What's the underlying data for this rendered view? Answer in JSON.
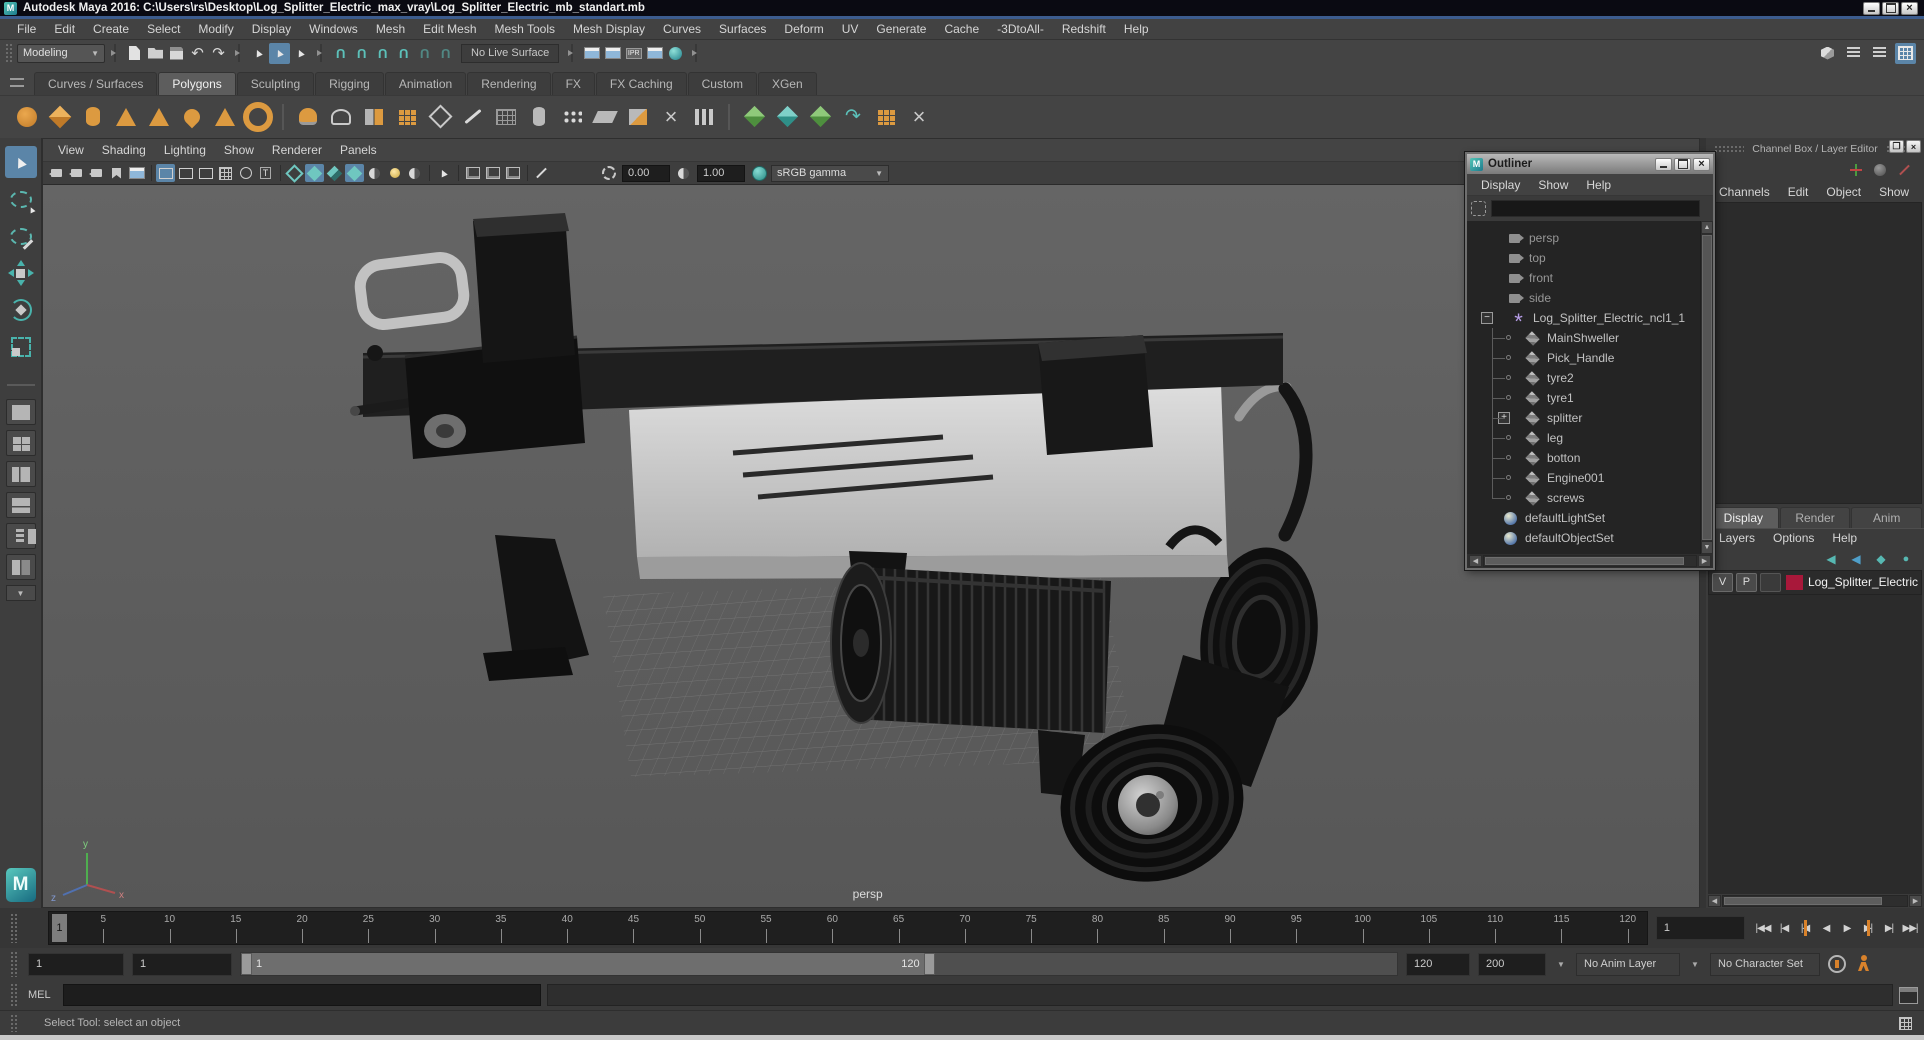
{
  "window": {
    "title": "Autodesk Maya 2016: C:\\Users\\rs\\Desktop\\Log_Splitter_Electric_max_vray\\Log_Splitter_Electric_mb_standart.mb"
  },
  "menu_bar": [
    "File",
    "Edit",
    "Create",
    "Select",
    "Modify",
    "Display",
    "Windows",
    "Mesh",
    "Edit Mesh",
    "Mesh Tools",
    "Mesh Display",
    "Curves",
    "Surfaces",
    "Deform",
    "UV",
    "Generate",
    "Cache",
    "-3DtoAll-",
    "Redshift",
    "Help"
  ],
  "status_line": {
    "mode_selector": "Modeling",
    "live_surface": "No Live Surface",
    "file_icons": [
      {
        "name": "new-scene-icon",
        "cls": "g-doc"
      },
      {
        "name": "open-scene-icon",
        "cls": "g-folder"
      },
      {
        "name": "save-scene-icon",
        "cls": "g-save"
      },
      {
        "name": "undo-icon",
        "cls": "g-undo"
      },
      {
        "name": "redo-icon",
        "cls": "g-redo"
      }
    ],
    "select_icons": [
      {
        "name": "select-hierarchy-icon",
        "cls": "g-cursor"
      },
      {
        "name": "select-object-icon",
        "cls": "g-cursor active"
      },
      {
        "name": "select-component-icon",
        "cls": "g-cursor"
      }
    ],
    "snap_icons": [
      {
        "name": "snap-grid-icon",
        "cls": "g-magnet"
      },
      {
        "name": "snap-curve-icon",
        "cls": "g-magnet"
      },
      {
        "name": "snap-point-icon",
        "cls": "g-magnet"
      },
      {
        "name": "snap-view-plane-icon",
        "cls": "g-magnet"
      },
      {
        "name": "snap-surface-icon",
        "cls": "g-magnet dim"
      },
      {
        "name": "make-live-icon",
        "cls": "g-magnet dim"
      }
    ],
    "render_icons": [
      {
        "name": "render-view-icon",
        "cls": "g-render"
      },
      {
        "name": "render-current-frame-icon",
        "cls": "g-render"
      },
      {
        "name": "ipr-render-icon",
        "cls": "g-ipr"
      },
      {
        "name": "render-settings-icon",
        "cls": "g-render"
      },
      {
        "name": "render-setup-icon",
        "cls": "g-sphere"
      }
    ],
    "sidebar_icons": [
      {
        "name": "modeling-toolkit-icon",
        "cls": "g-mtk"
      },
      {
        "name": "tool-settings-icon",
        "cls": "g-attred"
      },
      {
        "name": "attribute-editor-icon",
        "cls": "g-attred"
      },
      {
        "name": "channel-box-icon",
        "cls": "g-chbox active"
      }
    ]
  },
  "shelf": {
    "tabs": [
      {
        "label": "Curves / Surfaces"
      },
      {
        "label": "Polygons",
        "cls": "active"
      },
      {
        "label": "Sculpting"
      },
      {
        "label": "Rigging"
      },
      {
        "label": "Animation"
      },
      {
        "label": "Rendering"
      },
      {
        "label": "FX"
      },
      {
        "label": "FX Caching"
      },
      {
        "label": "Custom"
      },
      {
        "label": "XGen"
      }
    ],
    "icons": [
      {
        "name": "poly-sphere-icon",
        "cls": "s-circle"
      },
      {
        "name": "poly-cube-icon",
        "cls": "s-diam"
      },
      {
        "name": "poly-cylinder-icon",
        "cls": "s-cyl"
      },
      {
        "name": "poly-cone-icon",
        "cls": "s-tri"
      },
      {
        "name": "poly-pyramid-icon",
        "cls": "s-tri"
      },
      {
        "name": "poly-helix-icon",
        "cls": "s-drop"
      },
      {
        "name": "poly-prism-icon",
        "cls": "s-tri"
      },
      {
        "name": "poly-torus-icon",
        "cls": "s-ring"
      },
      {
        "name": "shelf-separator",
        "cls": "s-sep"
      },
      {
        "name": "smooth-mesh-icon",
        "cls": "s-dome"
      },
      {
        "name": "subdiv-proxy-icon",
        "cls": "s-dome-o"
      },
      {
        "name": "combine-icon",
        "cls": "s-duo"
      },
      {
        "name": "extrude-icon",
        "cls": "s-gridor"
      },
      {
        "name": "bevel-icon",
        "cls": "s-diam-o"
      },
      {
        "name": "multi-cut-icon",
        "cls": "s-pen"
      },
      {
        "name": "quad-draw-icon",
        "cls": "s-pengrid"
      },
      {
        "name": "insert-edge-loop-icon",
        "cls": "s-cylg"
      },
      {
        "name": "offset-edge-loop-icon",
        "cls": "s-dots"
      },
      {
        "name": "append-polygon-icon",
        "cls": "s-planeg"
      },
      {
        "name": "sculpt-tool-icon",
        "cls": "s-half"
      },
      {
        "name": "mirror-icon",
        "cls": "s-xbox"
      },
      {
        "name": "project-curve-icon",
        "cls": "s-cols"
      },
      {
        "name": "shelf-separator",
        "cls": "s-sep"
      },
      {
        "name": "boolean-union-icon",
        "cls": "s-green s-cube2"
      },
      {
        "name": "boolean-difference-icon",
        "cls": "s-teal s-cube2"
      },
      {
        "name": "boolean-intersection-icon",
        "cls": "s-green s-cube2"
      },
      {
        "name": "mirror-geometry-icon",
        "cls": "s-arrow"
      },
      {
        "name": "quadrangulate-icon",
        "cls": "s-gridor"
      },
      {
        "name": "cleanup-icon",
        "cls": "s-x"
      }
    ]
  },
  "viewport": {
    "panel_menus": [
      "View",
      "Shading",
      "Lighting",
      "Show",
      "Renderer",
      "Panels"
    ],
    "toolbar": {
      "exposure": "0.00",
      "gamma": "1.00",
      "view_transform": "sRGB gamma",
      "icons": [
        {
          "name": "select-camera-icon",
          "cls": "g-cam"
        },
        {
          "name": "lock-camera-icon",
          "cls": "g-cam"
        },
        {
          "name": "camera-attributes-icon",
          "cls": "g-cam"
        },
        {
          "name": "bookmarks-icon",
          "cls": "g-flag"
        },
        {
          "name": "image-plane-icon",
          "cls": "g-render"
        },
        {
          "name": "toolbar-separator",
          "cls": "vt-sep"
        },
        {
          "name": "film-gate-icon",
          "cls": "g-gate active"
        },
        {
          "name": "resolution-gate-icon",
          "cls": "g-gate"
        },
        {
          "name": "gate-mask-icon",
          "cls": "g-gate"
        },
        {
          "name": "field-chart-icon",
          "cls": "g-grid"
        },
        {
          "name": "safe-action-icon",
          "cls": "g-circ-o"
        },
        {
          "name": "safe-title-icon",
          "cls": "g-Trect"
        },
        {
          "name": "toolbar-separator",
          "cls": "vt-sep"
        },
        {
          "name": "wireframe-icon",
          "cls": "g-diam-o"
        },
        {
          "name": "smooth-shade-icon",
          "cls": "g-diam active"
        },
        {
          "name": "bounding-box-icon",
          "cls": "g-diam-half"
        },
        {
          "name": "textured-icon",
          "cls": "g-diam active"
        },
        {
          "name": "use-default-material-icon",
          "cls": "g-halfmoon"
        },
        {
          "name": "lighting-icon",
          "cls": "g-bulb"
        },
        {
          "name": "shadows-icon",
          "cls": "g-halfmoon"
        },
        {
          "name": "toolbar-separator",
          "cls": "vt-sep"
        },
        {
          "name": "isolate-select-icon",
          "cls": "g-cursor"
        },
        {
          "name": "toolbar-separator",
          "cls": "vt-sep"
        },
        {
          "name": "copy-pane-icon",
          "cls": "g-pane"
        },
        {
          "name": "paste-pane-icon",
          "cls": "g-pane"
        },
        {
          "name": "pane-layout-icon",
          "cls": "g-pane"
        },
        {
          "name": "toolbar-separator",
          "cls": "vt-sep"
        },
        {
          "name": "grease-pencil-icon",
          "cls": "g-pen"
        }
      ]
    },
    "camera_label": "persp",
    "axis": {
      "x": "x",
      "y": "y",
      "z": "z"
    }
  },
  "outliner": {
    "title": "Outliner",
    "menus": [
      "Display",
      "Show",
      "Help"
    ],
    "search_value": "",
    "items": [
      {
        "label": "persp",
        "cls": "cam"
      },
      {
        "label": "top",
        "cls": "cam"
      },
      {
        "label": "front",
        "cls": "cam"
      },
      {
        "label": "side",
        "cls": "cam"
      },
      {
        "label": "Log_Splitter_Electric_ncl1_1",
        "cls": "group expand-minus"
      },
      {
        "label": "MainShweller",
        "cls": "mesh child"
      },
      {
        "label": "Pick_Handle",
        "cls": "mesh child"
      },
      {
        "label": "tyre2",
        "cls": "mesh child"
      },
      {
        "label": "tyre1",
        "cls": "mesh child"
      },
      {
        "label": "splitter",
        "cls": "mesh child expand-plus"
      },
      {
        "label": "leg",
        "cls": "mesh child"
      },
      {
        "label": "botton",
        "cls": "mesh child"
      },
      {
        "label": "Engine001",
        "cls": "mesh child"
      },
      {
        "label": "screws",
        "cls": "mesh child last"
      },
      {
        "label": "defaultLightSet",
        "cls": "set"
      },
      {
        "label": "defaultObjectSet",
        "cls": "set"
      }
    ]
  },
  "channel_box": {
    "title": "Channel Box / Layer Editor",
    "menus": [
      "Channels",
      "Edit",
      "Object",
      "Show"
    ],
    "mini_icons": [
      {
        "name": "manipulator-icon",
        "cls": "g-manip"
      },
      {
        "name": "speed-sphere-icon",
        "cls": "g-spherec"
      },
      {
        "name": "speed-linear-icon",
        "cls": "g-slash"
      }
    ]
  },
  "layer_editor": {
    "tabs": [
      {
        "label": "Display",
        "cls": "active"
      },
      {
        "label": "Render"
      },
      {
        "label": "Anim"
      }
    ],
    "menus": [
      "Layers",
      "Options",
      "Help"
    ],
    "icons": [
      {
        "name": "move-layer-up-icon",
        "cls": "g-lmove"
      },
      {
        "name": "move-layer-down-icon",
        "cls": "g-lmove down"
      },
      {
        "name": "new-empty-layer-icon",
        "cls": "g-lnew"
      },
      {
        "name": "new-layer-assign-icon",
        "cls": "g-ldot"
      }
    ],
    "layer": {
      "v": "V",
      "p": "P",
      "name": "Log_Splitter_Electric",
      "color": "#a8183a"
    }
  },
  "timeline": {
    "ticks": [
      5,
      10,
      15,
      20,
      25,
      30,
      35,
      40,
      45,
      50,
      55,
      60,
      65,
      70,
      75,
      80,
      85,
      90,
      95,
      100,
      105,
      110,
      115,
      120
    ],
    "current_frame": "1",
    "current_frame_field": "1",
    "playback": [
      {
        "g": "|◀◀",
        "name": "go-to-start-button"
      },
      {
        "g": "|◀",
        "name": "step-back-frame-button"
      },
      {
        "g": "|◀",
        "name": "step-back-key-button",
        "cls": "key"
      },
      {
        "g": "◀",
        "name": "play-backwards-button"
      },
      {
        "g": "▶",
        "name": "play-forwards-button"
      },
      {
        "g": "▶|",
        "name": "step-forward-key-button",
        "cls": "key"
      },
      {
        "g": "▶|",
        "name": "step-forward-frame-button"
      },
      {
        "g": "▶▶|",
        "name": "go-to-end-button"
      }
    ]
  },
  "range_slider": {
    "anim_start": "1",
    "playback_start": "1",
    "bar_start_label": "1",
    "bar_end_label": "120",
    "playback_end": "120",
    "anim_end": "200",
    "anim_layer": "No Anim Layer",
    "character_set": "No Character Set"
  },
  "command_line": {
    "label": "MEL",
    "input": ""
  },
  "help_line": {
    "text": "Select Tool: select an object"
  }
}
